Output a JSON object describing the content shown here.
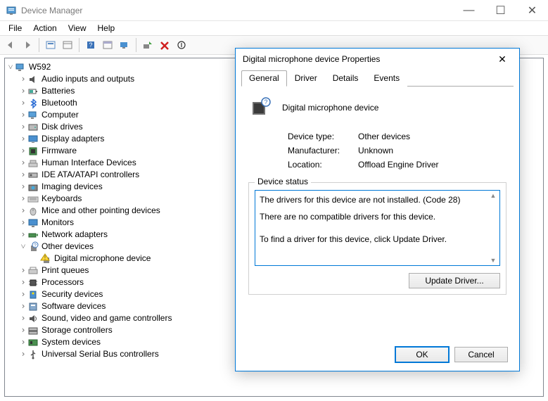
{
  "window": {
    "title": "Device Manager",
    "min": "—",
    "max": "☐",
    "close": "✕"
  },
  "menu": [
    "File",
    "Action",
    "View",
    "Help"
  ],
  "tree": {
    "root": "W592",
    "items": [
      {
        "label": "Audio inputs and outputs",
        "exp": ">"
      },
      {
        "label": "Batteries",
        "exp": ">"
      },
      {
        "label": "Bluetooth",
        "exp": ">"
      },
      {
        "label": "Computer",
        "exp": ">"
      },
      {
        "label": "Disk drives",
        "exp": ">"
      },
      {
        "label": "Display adapters",
        "exp": ">"
      },
      {
        "label": "Firmware",
        "exp": ">"
      },
      {
        "label": "Human Interface Devices",
        "exp": ">"
      },
      {
        "label": "IDE ATA/ATAPI controllers",
        "exp": ">"
      },
      {
        "label": "Imaging devices",
        "exp": ">"
      },
      {
        "label": "Keyboards",
        "exp": ">"
      },
      {
        "label": "Mice and other pointing devices",
        "exp": ">"
      },
      {
        "label": "Monitors",
        "exp": ">"
      },
      {
        "label": "Network adapters",
        "exp": ">"
      },
      {
        "label": "Other devices",
        "exp": "v",
        "child": "Digital microphone device"
      },
      {
        "label": "Print queues",
        "exp": ">"
      },
      {
        "label": "Processors",
        "exp": ">"
      },
      {
        "label": "Security devices",
        "exp": ">"
      },
      {
        "label": "Software devices",
        "exp": ">"
      },
      {
        "label": "Sound, video and game controllers",
        "exp": ">"
      },
      {
        "label": "Storage controllers",
        "exp": ">"
      },
      {
        "label": "System devices",
        "exp": ">"
      },
      {
        "label": "Universal Serial Bus controllers",
        "exp": ">"
      }
    ]
  },
  "dialog": {
    "title": "Digital microphone device Properties",
    "tabs": [
      "General",
      "Driver",
      "Details",
      "Events"
    ],
    "device_name": "Digital microphone device",
    "rows": {
      "type_k": "Device type:",
      "type_v": "Other devices",
      "mfr_k": "Manufacturer:",
      "mfr_v": "Unknown",
      "loc_k": "Location:",
      "loc_v": "Offload Engine Driver"
    },
    "status_legend": "Device status",
    "status_lines": [
      "The drivers for this device are not installed. (Code 28)",
      "There are no compatible drivers for this device.",
      "To find a driver for this device, click Update Driver."
    ],
    "update_btn": "Update Driver...",
    "ok": "OK",
    "cancel": "Cancel"
  }
}
